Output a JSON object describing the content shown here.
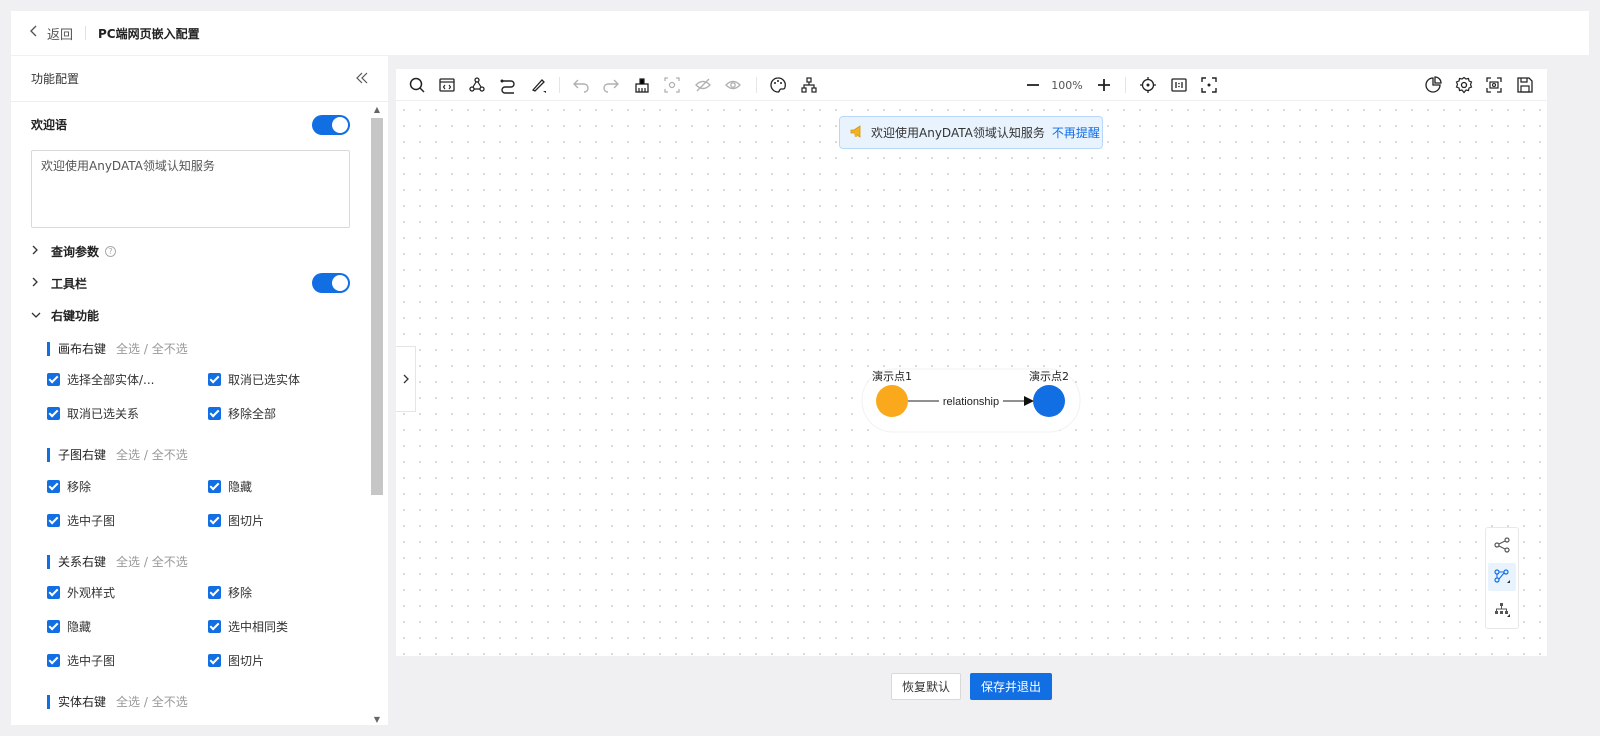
{
  "header": {
    "back_label": "返回",
    "title": "PC端网页嵌入配置"
  },
  "left_panel": {
    "title": "功能配置",
    "welcome": {
      "label": "欢迎语",
      "enabled": true,
      "text": "欢迎使用AnyDATA领域认知服务"
    },
    "query_params": {
      "label": "查询参数"
    },
    "toolbar": {
      "label": "工具栏",
      "enabled": true
    },
    "context_menu": {
      "label": "右键功能",
      "select_all_label": "全选 / 全不选",
      "groups": [
        {
          "name": "画布右键",
          "items": [
            "选择全部实体/...",
            "取消已选实体",
            "取消已选关系",
            "移除全部"
          ]
        },
        {
          "name": "子图右键",
          "items": [
            "移除",
            "隐藏",
            "选中子图",
            "图切片"
          ]
        },
        {
          "name": "关系右键",
          "items": [
            "外观样式",
            "移除",
            "隐藏",
            "选中相同类",
            "选中子图",
            "图切片"
          ]
        },
        {
          "name": "实体右键"
        }
      ]
    }
  },
  "canvas": {
    "zoom": "100%",
    "notice": {
      "text": "欢迎使用AnyDATA领域认知服务",
      "link": "不再提醒"
    },
    "graph": {
      "nodes": [
        {
          "label": "演示点1",
          "color": "#f9a91b"
        },
        {
          "label": "演示点2",
          "color": "#126ee3"
        }
      ],
      "edge": {
        "label": "relationship"
      }
    },
    "toolbar_icons_left": [
      "search-icon",
      "code-icon",
      "graph-icon",
      "path-icon",
      "brush-icon",
      "undo-icon",
      "redo-icon",
      "clear-icon",
      "show-hidden-icon",
      "hide-icon",
      "view-icon",
      "palette-icon",
      "hierarchy-icon"
    ],
    "toolbar_icons_right": [
      "statistics-icon",
      "settings-icon",
      "screenshot-icon",
      "save-icon"
    ]
  },
  "footer": {
    "reset_label": "恢复默认",
    "save_exit_label": "保存并退出"
  },
  "colors": {
    "primary": "#126ee3",
    "node1": "#f9a91b",
    "node2": "#126ee3"
  }
}
